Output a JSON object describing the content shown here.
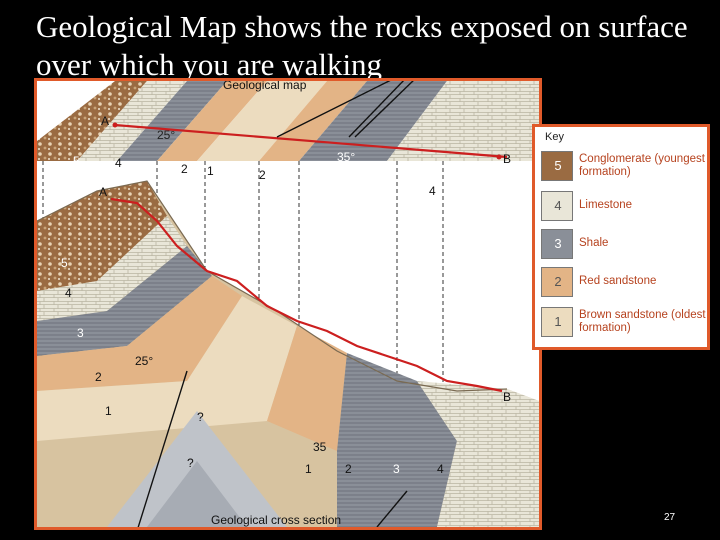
{
  "slide": {
    "title": "Geological Map shows the rocks exposed on surface over which you are walking",
    "page_number": "27"
  },
  "diagram": {
    "map_caption": "Geological map",
    "section_caption": "Geological cross section",
    "point_a_map": "A",
    "point_b_map": "B",
    "point_a_block": "A",
    "point_b_block": "B",
    "dip_map_left": "25°",
    "dip_map_right": "35°",
    "dip_section_left": "25°",
    "dip_section_right": "35",
    "unknown_1": "?",
    "unknown_2": "?",
    "map_units": [
      "5",
      "4",
      "3",
      "2",
      "1",
      "2",
      "3",
      "4"
    ],
    "front_units_left": [
      "5",
      "4",
      "3",
      "2",
      "1"
    ],
    "front_units_bottom": [
      "1",
      "2",
      "3",
      "4"
    ]
  },
  "key": {
    "title": "Key",
    "items": [
      {
        "num": "5",
        "label": "Conglomerate (youngest formation)",
        "color": "#9a6b42"
      },
      {
        "num": "4",
        "label": "Limestone",
        "color": "#e9e6d8"
      },
      {
        "num": "3",
        "label": "Shale",
        "color": "#8a8f98"
      },
      {
        "num": "2",
        "label": "Red sandstone",
        "color": "#e3b486"
      },
      {
        "num": "1",
        "label": "Brown sandstone (oldest formation)",
        "color": "#ecdcbf"
      }
    ]
  }
}
